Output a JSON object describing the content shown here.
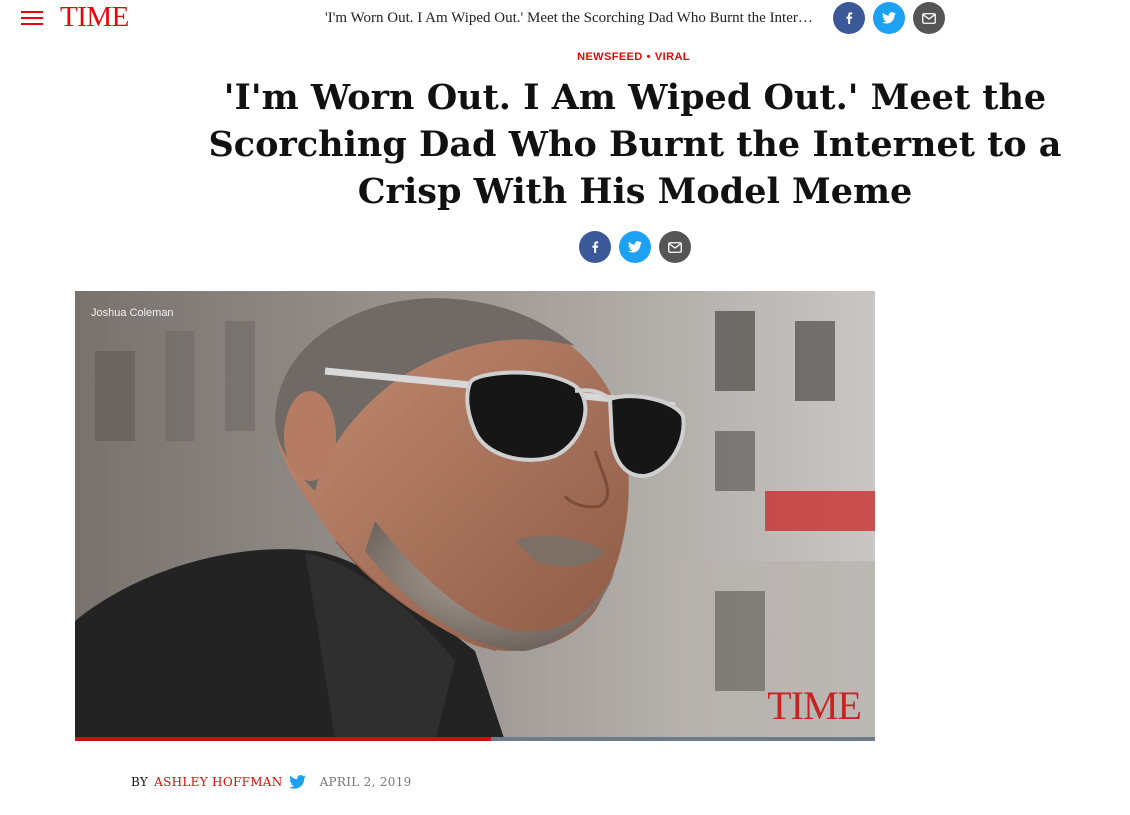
{
  "header": {
    "logo": "TIME",
    "title": "'I'm Worn Out. I Am Wiped Out.' Meet the Scorching Dad Who Burnt the Internet to a Crisp With His Model Meme",
    "share_icons": [
      "facebook-icon",
      "twitter-icon",
      "email-icon"
    ]
  },
  "article": {
    "kicker": {
      "section1": "NEWSFEED",
      "separator": "•",
      "section2": "VIRAL"
    },
    "headline": "'I'm Worn Out. I Am Wiped Out.' Meet the Scorching Dad Who Burnt the Internet to a Crisp With His Model Meme",
    "hero": {
      "credit": "Joshua Coleman",
      "watermark": "TIME",
      "progress": 0.52
    },
    "byline": {
      "prefix": "BY",
      "author": "ASHLEY HOFFMAN",
      "date": "APRIL 2, 2019"
    }
  },
  "colors": {
    "brand": "#e90606",
    "facebook": "#3b5998",
    "twitter": "#1da1f2",
    "email": "#555555"
  }
}
